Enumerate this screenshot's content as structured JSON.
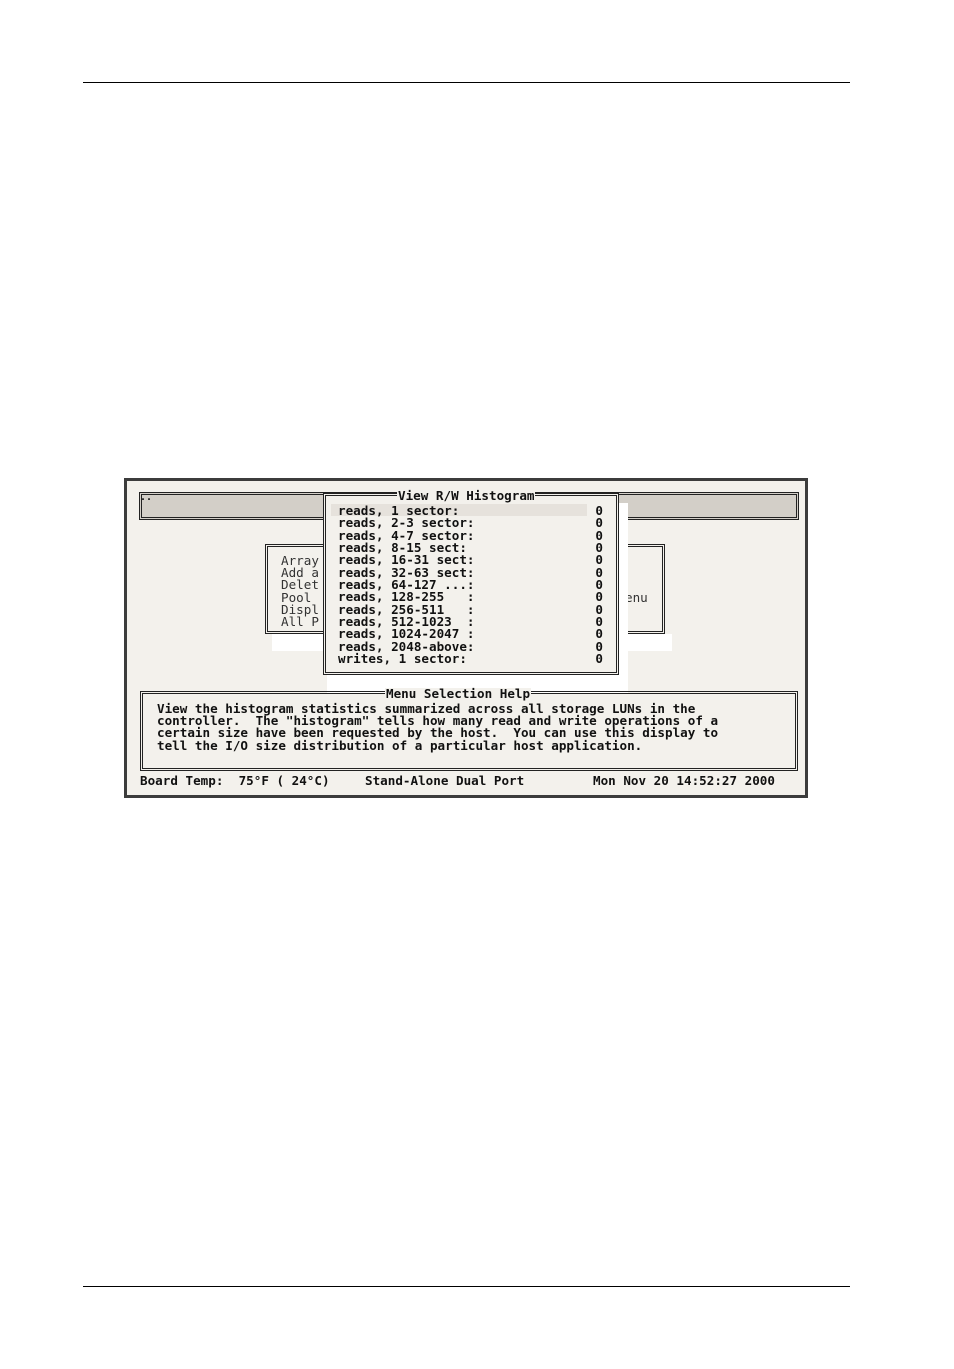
{
  "window": {
    "corner": "..",
    "menu_items": [
      "Array",
      "Add a",
      "Delet",
      "Pool",
      "Displ",
      "All P"
    ],
    "menu_fragment": "enu"
  },
  "histogram": {
    "title": "View R/W Histogram",
    "rows": [
      {
        "label": "reads, 1 sector:",
        "value": "0"
      },
      {
        "label": "reads, 2-3 sector:",
        "value": "0"
      },
      {
        "label": "reads, 4-7 sector:",
        "value": "0"
      },
      {
        "label": "reads, 8-15 sect:",
        "value": "0"
      },
      {
        "label": "reads, 16-31 sect:",
        "value": "0"
      },
      {
        "label": "reads, 32-63 sect:",
        "value": "0"
      },
      {
        "label": "reads, 64-127 ...:",
        "value": "0"
      },
      {
        "label": "reads, 128-255   :",
        "value": "0"
      },
      {
        "label": "reads, 256-511   :",
        "value": "0"
      },
      {
        "label": "reads, 512-1023  :",
        "value": "0"
      },
      {
        "label": "reads, 1024-2047 :",
        "value": "0"
      },
      {
        "label": "reads, 2048-above:",
        "value": "0"
      },
      {
        "label": "writes, 1 sector:",
        "value": "0"
      }
    ]
  },
  "help": {
    "title": "Menu Selection Help",
    "lines": [
      "View the histogram statistics summarized across all storage LUNs in the",
      "controller.  The \"histogram\" tells how many read and write operations of a",
      "certain size have been requested by the host.  You can use this display to",
      "tell the I/O size distribution of a particular host application."
    ]
  },
  "status_bar": {
    "temp": "Board Temp:  75°F ( 24°C)",
    "mode": "Stand-Alone Dual Port",
    "datetime": "Mon Nov 20 14:52:27 2000"
  }
}
